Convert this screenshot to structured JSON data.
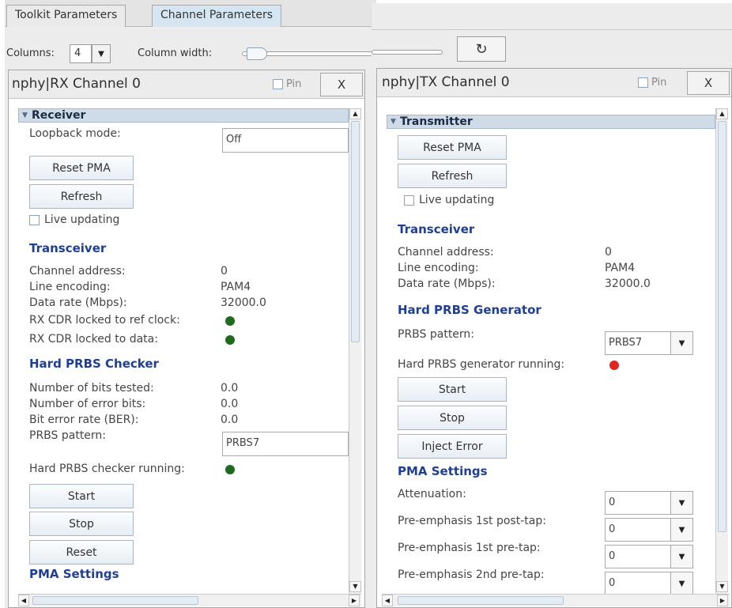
{
  "tabs": [
    "Toolkit Parameters",
    "Channel Parameters"
  ],
  "toolbar": {
    "columns_label": "Columns:",
    "columns_value": "4",
    "column_width_label": "Column width:",
    "refresh_icon": "↻"
  },
  "icons": {
    "dropdown": "▼",
    "scroll_up": "▲",
    "scroll_down": "▼",
    "scroll_left": "◀",
    "scroll_right": "▶",
    "section_toggle": "▼"
  },
  "colors": {
    "status_green": "#1e6b1e",
    "status_red": "#e0261f",
    "heading_blue": "#1f3f95",
    "section_bar": "#cfdce8"
  },
  "rx_panel": {
    "title": "nphy|RX Channel 0",
    "pin_label": "Pin",
    "close_label": "X",
    "section": "Receiver",
    "loopback_label": "Loopback mode:",
    "loopback_value": "Off",
    "reset_pma": "Reset PMA",
    "refresh": "Refresh",
    "live_updating": "Live updating",
    "transceiver_heading": "Transceiver",
    "channel_address_label": "Channel address:",
    "channel_address_value": "0",
    "line_encoding_label": "Line encoding:",
    "line_encoding_value": "PAM4",
    "data_rate_label": "Data rate (Mbps):",
    "data_rate_value": "32000.0",
    "cdr_ref_label": "RX CDR locked to ref clock:",
    "cdr_data_label": "RX CDR locked to data:",
    "prbs_checker_heading": "Hard PRBS Checker",
    "bits_tested_label": "Number of bits tested:",
    "bits_tested_value": "0.0",
    "error_bits_label": "Number of error bits:",
    "error_bits_value": "0.0",
    "ber_label": "Bit error rate (BER):",
    "ber_value": "0.0",
    "prbs_pattern_label": "PRBS pattern:",
    "prbs_pattern_value": "PRBS7",
    "checker_running_label": "Hard PRBS checker running:",
    "start": "Start",
    "stop": "Stop",
    "reset": "Reset",
    "pma_heading": "PMA Settings"
  },
  "tx_panel": {
    "title": "nphy|TX Channel 0",
    "pin_label": "Pin",
    "close_label": "X",
    "section": "Transmitter",
    "reset_pma": "Reset PMA",
    "refresh": "Refresh",
    "live_updating": "Live updating",
    "transceiver_heading": "Transceiver",
    "channel_address_label": "Channel address:",
    "channel_address_value": "0",
    "line_encoding_label": "Line encoding:",
    "line_encoding_value": "PAM4",
    "data_rate_label": "Data rate (Mbps):",
    "data_rate_value": "32000.0",
    "prbs_generator_heading": "Hard PRBS Generator",
    "prbs_pattern_label": "PRBS pattern:",
    "prbs_pattern_value": "PRBS7",
    "generator_running_label": "Hard PRBS generator running:",
    "start": "Start",
    "stop": "Stop",
    "inject_error": "Inject Error",
    "pma_heading": "PMA Settings",
    "attenuation_label": "Attenuation:",
    "attenuation_value": "0",
    "pre1_post_label": "Pre-emphasis 1st post-tap:",
    "pre1_post_value": "0",
    "pre1_pre_label": "Pre-emphasis 1st pre-tap:",
    "pre1_pre_value": "0",
    "pre2_pre_label": "Pre-emphasis 2nd pre-tap:",
    "pre2_pre_value": "0"
  }
}
